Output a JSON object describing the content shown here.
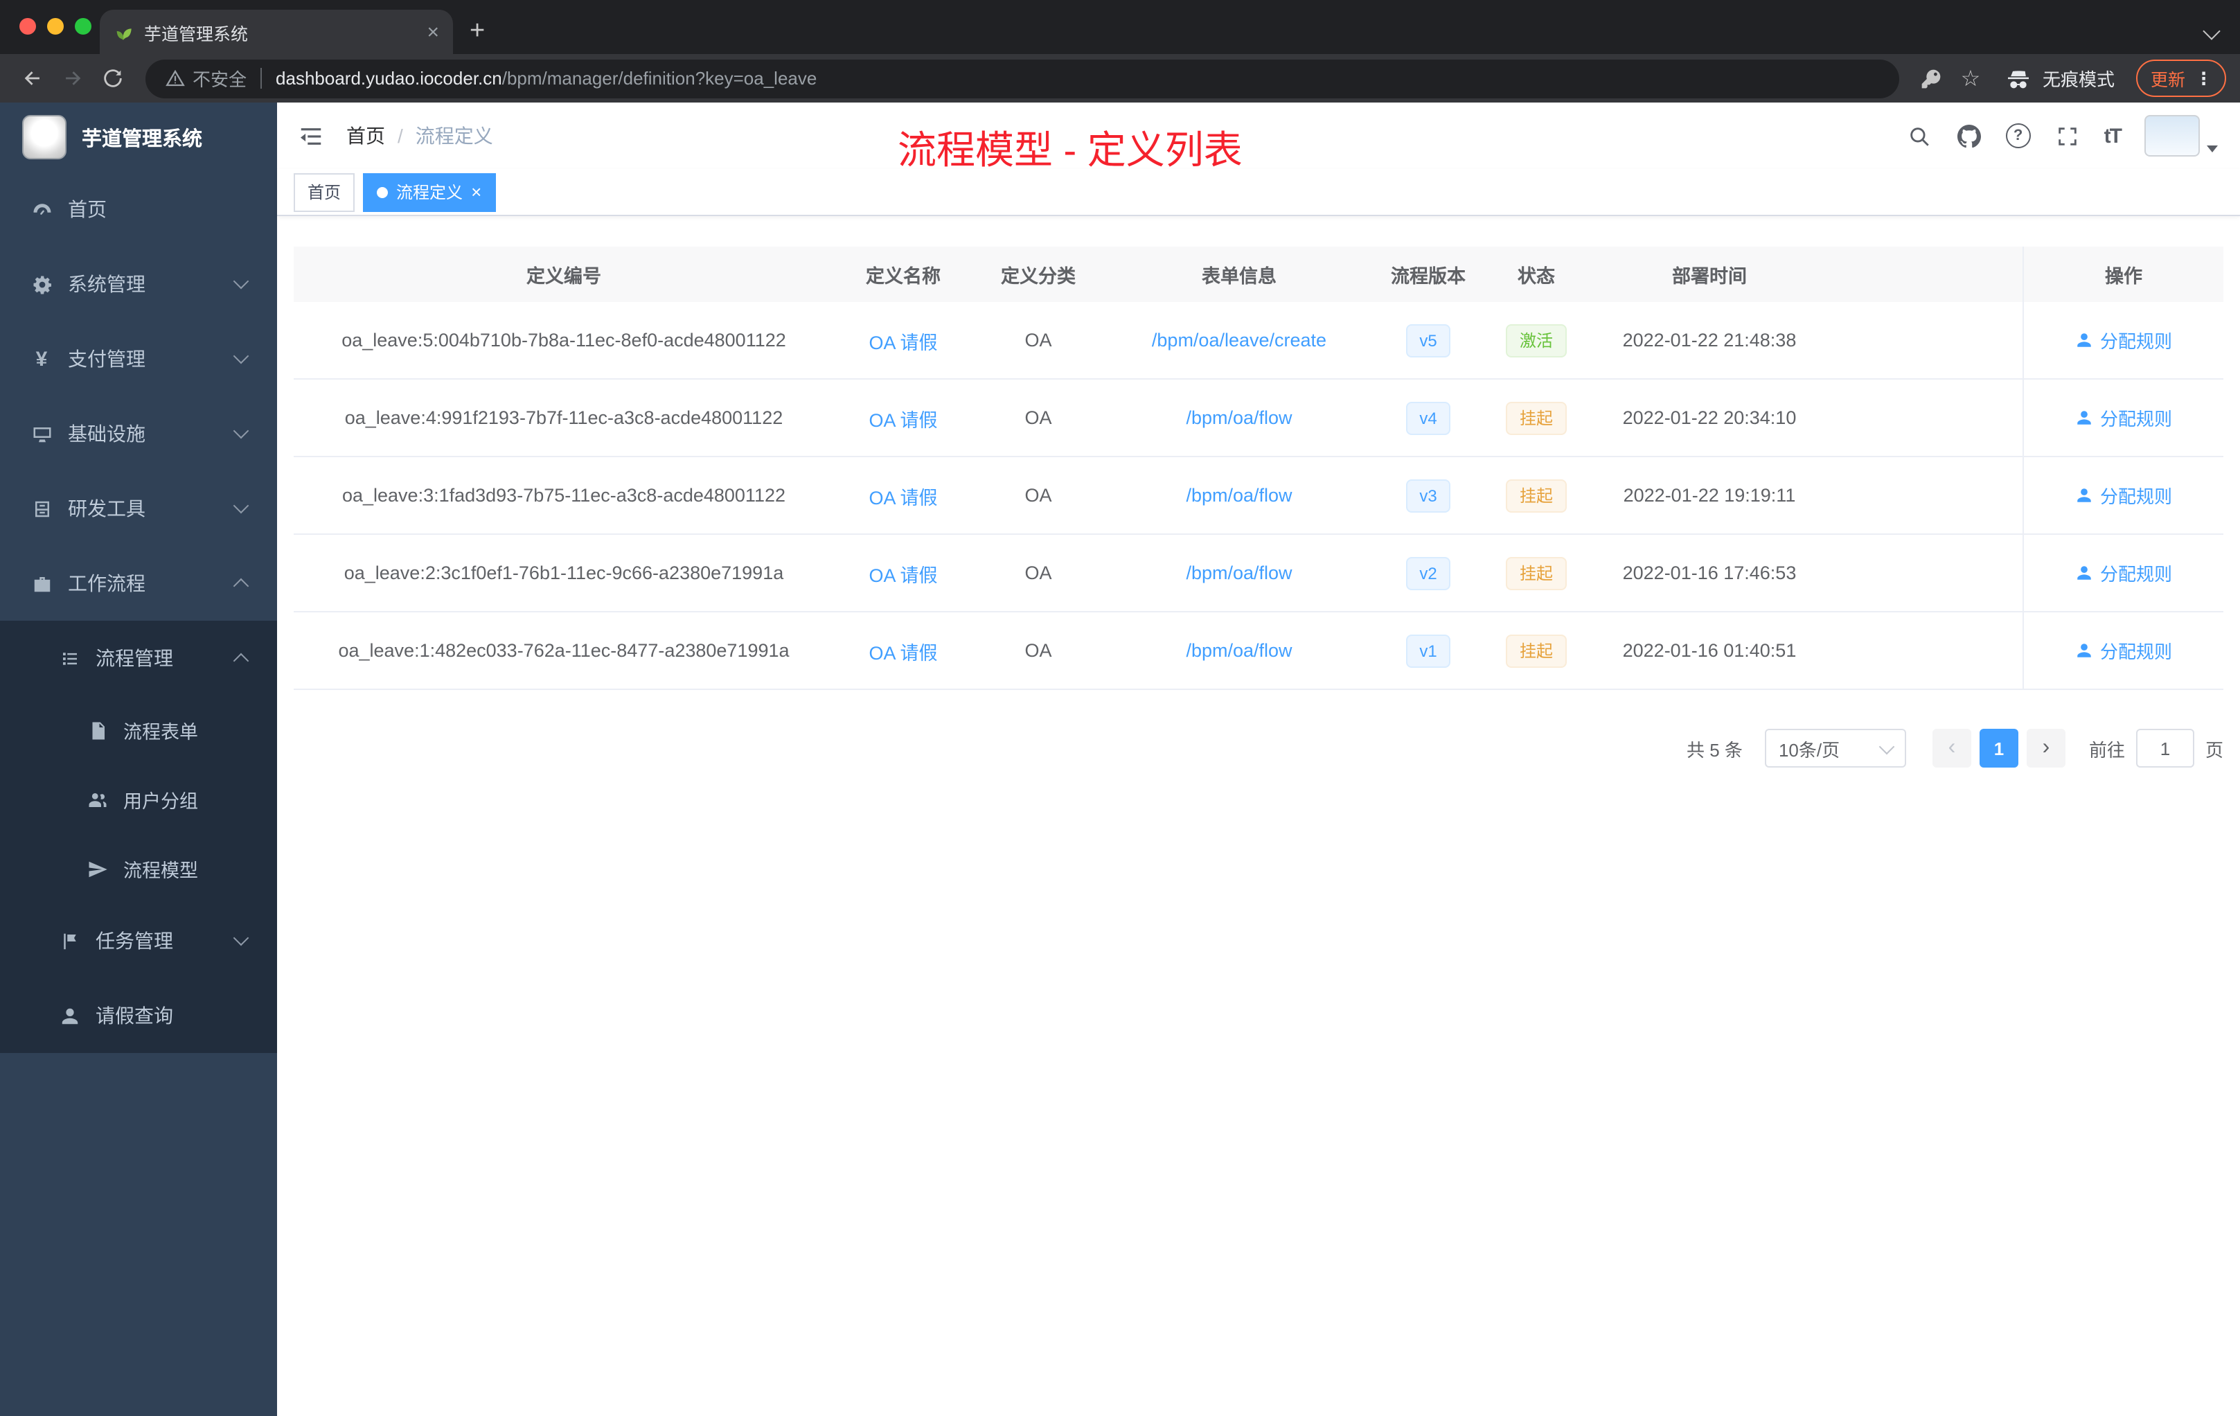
{
  "colors": {
    "accent": "#409eff",
    "success": "#67c23a",
    "warning": "#e6a23c",
    "annotation_red": "#f5222d",
    "sidebar_bg": "#304156",
    "submenu_bg": "#212d3d",
    "update_orange": "#ff7043"
  },
  "browser": {
    "tab_title": "芋道管理系统",
    "close_icon": "×",
    "new_tab_icon": "+",
    "security_label": "不安全",
    "url_host": "dashboard.yudao.iocoder.cn",
    "url_path": "/bpm/manager/definition?key=oa_leave",
    "incognito_label": "无痕模式",
    "update_label": "更新",
    "menu_icon": "⋮",
    "star_icon": "☆"
  },
  "sidebar": {
    "logo_title": "芋道管理系统",
    "items": [
      {
        "label": "首页",
        "icon": "dashboard-icon"
      },
      {
        "label": "系统管理",
        "icon": "gear-icon"
      },
      {
        "label": "支付管理",
        "icon": "payment-icon"
      },
      {
        "label": "基础设施",
        "icon": "infrastructure-icon"
      },
      {
        "label": "研发工具",
        "icon": "devtools-icon"
      },
      {
        "label": "工作流程",
        "icon": "workflow-icon"
      },
      {
        "label": "流程管理",
        "icon": "process-list-icon"
      },
      {
        "label": "流程表单",
        "icon": "form-icon"
      },
      {
        "label": "用户分组",
        "icon": "user-group-icon"
      },
      {
        "label": "流程模型",
        "icon": "paper-plane-icon"
      },
      {
        "label": "任务管理",
        "icon": "task-icon"
      },
      {
        "label": "请假查询",
        "icon": "person-icon"
      }
    ],
    "payment_glyph": "¥"
  },
  "header": {
    "breadcrumb_home": "首页",
    "breadcrumb_sep": "/",
    "breadcrumb_current": "流程定义",
    "annotation": "流程模型 - 定义列表",
    "font_size_icon_label": "tT",
    "question_icon_label": "?"
  },
  "tags": {
    "first": "首页",
    "active": "流程定义",
    "close_icon": "×"
  },
  "table": {
    "columns": [
      "定义编号",
      "定义名称",
      "定义分类",
      "表单信息",
      "流程版本",
      "状态",
      "部署时间",
      "操作"
    ],
    "rows": [
      {
        "id": "oa_leave:5:004b710b-7b8a-11ec-8ef0-acde48001122",
        "name": "OA 请假",
        "category": "OA",
        "form": "/bpm/oa/leave/create",
        "version": "v5",
        "status": "激活",
        "time": "2022-01-22 21:48:38",
        "action": "分配规则"
      },
      {
        "id": "oa_leave:4:991f2193-7b7f-11ec-a3c8-acde48001122",
        "name": "OA 请假",
        "category": "OA",
        "form": "/bpm/oa/flow",
        "version": "v4",
        "status": "挂起",
        "time": "2022-01-22 20:34:10",
        "action": "分配规则"
      },
      {
        "id": "oa_leave:3:1fad3d93-7b75-11ec-a3c8-acde48001122",
        "name": "OA 请假",
        "category": "OA",
        "form": "/bpm/oa/flow",
        "version": "v3",
        "status": "挂起",
        "time": "2022-01-22 19:19:11",
        "action": "分配规则"
      },
      {
        "id": "oa_leave:2:3c1f0ef1-76b1-11ec-9c66-a2380e71991a",
        "name": "OA 请假",
        "category": "OA",
        "form": "/bpm/oa/flow",
        "version": "v2",
        "status": "挂起",
        "time": "2022-01-16 17:46:53",
        "action": "分配规则"
      },
      {
        "id": "oa_leave:1:482ec033-762a-11ec-8477-a2380e71991a",
        "name": "OA 请假",
        "category": "OA",
        "form": "/bpm/oa/flow",
        "version": "v1",
        "status": "挂起",
        "time": "2022-01-16 01:40:51",
        "action": "分配规则"
      }
    ]
  },
  "pagination": {
    "total": "共 5 条",
    "page_size": "10条/页",
    "prev_icon": "‹",
    "next_icon": "›",
    "current": "1",
    "goto_label": "前往",
    "goto_value": "1",
    "unit": "页"
  }
}
